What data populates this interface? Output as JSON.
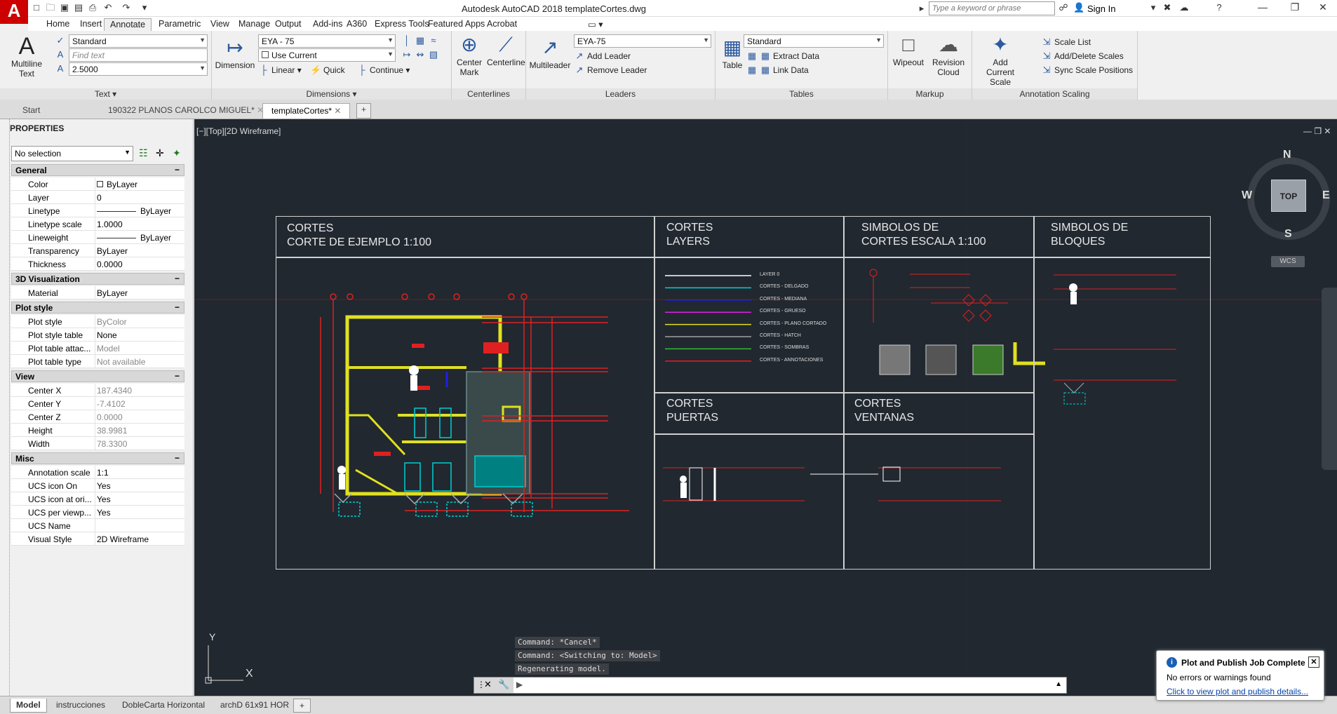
{
  "app": {
    "logo_letter": "A",
    "window_title": "Autodesk AutoCAD 2018   templateCortes.dwg",
    "search_placeholder": "Type a keyword or phrase",
    "sign_in": "Sign In"
  },
  "ribbon_tabs": [
    "Home",
    "Insert",
    "Annotate",
    "Parametric",
    "View",
    "Manage",
    "Output",
    "Add-ins",
    "A360",
    "Express Tools",
    "Featured Apps",
    "Acrobat"
  ],
  "ribbon_active_tab": "Annotate",
  "ribbon": {
    "text_panel": {
      "title": "Text",
      "multiline_label": "Multiline Text",
      "style_value": "Standard",
      "find_placeholder": "Find text",
      "height_value": "2.5000"
    },
    "dimensions_panel": {
      "title": "Dimensions",
      "dimension_label": "Dimension",
      "style_value": "EYA - 75",
      "layer_value": "Use Current",
      "linear_label": "Linear",
      "quick_label": "Quick",
      "continue_label": "Continue"
    },
    "centerlines_panel": {
      "title": "Centerlines",
      "center_mark_label": "Center Mark",
      "centerline_label": "Centerline"
    },
    "leaders_panel": {
      "title": "Leaders",
      "multileader_label": "Multileader",
      "style_value": "EYA-75",
      "add_leader": "Add Leader",
      "remove_leader": "Remove Leader"
    },
    "tables_panel": {
      "title": "Tables",
      "table_label": "Table",
      "style_value": "Standard",
      "extract_data": "Extract Data",
      "link_data": "Link Data"
    },
    "markup_panel": {
      "title": "Markup",
      "wipeout_label": "Wipeout",
      "revision_cloud_label": "Revision Cloud"
    },
    "annotation_scaling_panel": {
      "title": "Annotation Scaling",
      "add_current_scale": "Add Current Scale",
      "scale_list": "Scale List",
      "add_delete_scales": "Add/Delete Scales",
      "sync_scale_positions": "Sync Scale Positions"
    }
  },
  "doc_tabs": [
    "Start",
    "190322 PLANOS CAROLCO MIGUEL*",
    "templateCortes*"
  ],
  "doc_active_tab": "templateCortes*",
  "properties": {
    "title": "PROPERTIES",
    "selection": "No selection",
    "sections": [
      {
        "name": "General",
        "rows": [
          {
            "k": "Color",
            "v": "ByLayer",
            "swatch": true
          },
          {
            "k": "Layer",
            "v": "0"
          },
          {
            "k": "Linetype",
            "v": "ByLayer",
            "line": true
          },
          {
            "k": "Linetype scale",
            "v": "1.0000"
          },
          {
            "k": "Lineweight",
            "v": "ByLayer",
            "line": true
          },
          {
            "k": "Transparency",
            "v": "ByLayer"
          },
          {
            "k": "Thickness",
            "v": "0.0000"
          }
        ]
      },
      {
        "name": "3D Visualization",
        "rows": [
          {
            "k": "Material",
            "v": "ByLayer"
          }
        ]
      },
      {
        "name": "Plot style",
        "rows": [
          {
            "k": "Plot style",
            "v": "ByColor",
            "gray": true
          },
          {
            "k": "Plot style table",
            "v": "None"
          },
          {
            "k": "Plot table attac...",
            "v": "Model",
            "gray": true
          },
          {
            "k": "Plot table type",
            "v": "Not available",
            "gray": true
          }
        ]
      },
      {
        "name": "View",
        "rows": [
          {
            "k": "Center X",
            "v": "187.4340",
            "gray": true
          },
          {
            "k": "Center Y",
            "v": "-7.4102",
            "gray": true
          },
          {
            "k": "Center Z",
            "v": "0.0000",
            "gray": true
          },
          {
            "k": "Height",
            "v": "38.9981",
            "gray": true
          },
          {
            "k": "Width",
            "v": "78.3300",
            "gray": true
          }
        ]
      },
      {
        "name": "Misc",
        "rows": [
          {
            "k": "Annotation scale",
            "v": "1:1"
          },
          {
            "k": "UCS icon On",
            "v": "Yes"
          },
          {
            "k": "UCS icon at ori...",
            "v": "Yes"
          },
          {
            "k": "UCS per viewp...",
            "v": "Yes"
          },
          {
            "k": "UCS Name",
            "v": ""
          },
          {
            "k": "Visual Style",
            "v": "2D Wireframe"
          }
        ]
      }
    ]
  },
  "viewport": {
    "label": "[−][Top][2D Wireframe]",
    "viewcube_top": "TOP",
    "compass": {
      "n": "N",
      "s": "S",
      "e": "E",
      "w": "W"
    },
    "wcs": "WCS",
    "ucs_x": "X",
    "ucs_y": "Y"
  },
  "drawing": {
    "frame_titles": [
      "CORTES\nCORTE DE EJEMPLO 1:100",
      "CORTES\nLAYERS",
      "SIMBOLOS DE\nCORTES ESCALA 1:100",
      "SIMBOLOS DE\nBLOQUES",
      "CORTES\nPUERTAS",
      "CORTES\nVENTANAS"
    ],
    "layers": [
      {
        "name": "LAYER 0",
        "color": "#ffffff"
      },
      {
        "name": "CORTES - DELGADO",
        "color": "#00d0d0"
      },
      {
        "name": "CORTES - MEDIANA",
        "color": "#2020e0"
      },
      {
        "name": "CORTES - GRUESO",
        "color": "#e020e0"
      },
      {
        "name": "CORTES - PLANO CORTADO",
        "color": "#e0e020"
      },
      {
        "name": "CORTES - HATCH",
        "color": "#a0a0a0"
      },
      {
        "name": "CORTES - SOMBRAS",
        "color": "#30c030"
      },
      {
        "name": "CORTES - ANNOTACIONES",
        "color": "#e02020"
      }
    ]
  },
  "command": {
    "history": [
      "Command: *Cancel*",
      "Command:   <Switching to: Model>",
      "Regenerating model."
    ],
    "input_value": ""
  },
  "layout_tabs": [
    "Model",
    "instrucciones",
    "DobleCarta Horizontal",
    "archD 61x91 HOR"
  ],
  "layout_active": "Model",
  "notification": {
    "title": "Plot and Publish Job Complete",
    "body": "No errors or warnings found",
    "link": "Click to view plot and publish details..."
  }
}
